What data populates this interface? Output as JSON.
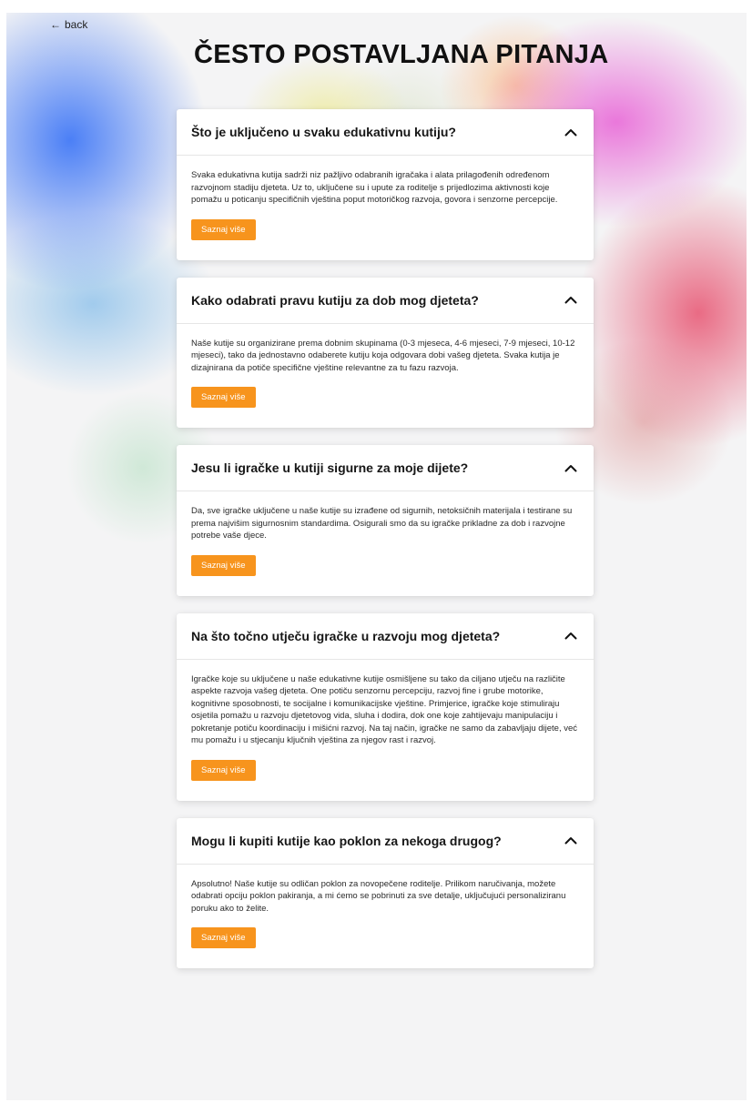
{
  "nav": {
    "back_arrow": "←",
    "back_label": "back"
  },
  "page": {
    "title": "ČESTO POSTAVLJANA PITANJA"
  },
  "faq": {
    "items": [
      {
        "question": "Što je uključeno u svaku edukativnu kutiju?",
        "answer": "Svaka edukativna kutija sadrži niz pažljivo odabranih igračaka i alata prilagođenih određenom razvojnom stadiju djeteta. Uz to, uključene su i upute za roditelje s prijedlozima aktivnosti koje pomažu u poticanju specifičnih vještina poput motoričkog razvoja, govora i senzorne percepcije.",
        "button_label": "Saznaj više",
        "expanded_icon": "chevron-up-icon"
      },
      {
        "question": "Kako odabrati pravu kutiju za dob mog djeteta?",
        "answer": "Naše kutije su organizirane prema dobnim skupinama (0-3 mjeseca, 4-6 mjeseci, 7-9 mjeseci, 10-12 mjeseci), tako da jednostavno odaberete kutiju koja odgovara dobi vašeg djeteta. Svaka kutija je dizajnirana da potiče specifične vještine relevantne za tu fazu razvoja.",
        "button_label": "Saznaj više",
        "expanded_icon": "chevron-up-icon"
      },
      {
        "question": "Jesu li igračke u kutiji sigurne za moje dijete?",
        "answer": "Da, sve igračke uključene u naše kutije su izrađene od sigurnih, netoksičnih materijala i testirane su prema najvišim sigurnosnim standardima. Osigurali smo da su igračke prikladne za dob i razvojne potrebe vaše djece.",
        "button_label": "Saznaj više",
        "expanded_icon": "chevron-up-icon"
      },
      {
        "question": "Na što točno utječu igračke u razvoju mog djeteta?",
        "answer": "Igračke koje su uključene u naše edukativne kutije osmišljene su tako da ciljano utječu na različite aspekte razvoja vašeg djeteta. One potiču senzornu percepciju, razvoj fine i grube motorike, kognitivne sposobnosti, te socijalne i komunikacijske vještine. Primjerice, igračke koje stimuliraju osjetila pomažu u razvoju djetetovog vida, sluha i dodira, dok one koje zahtijevaju manipulaciju i pokretanje potiču koordinaciju i mišićni razvoj. Na taj način, igračke ne samo da zabavljaju dijete, već mu pomažu i u stjecanju ključnih vještina za njegov rast i razvoj.",
        "button_label": "Saznaj više",
        "expanded_icon": "chevron-up-icon"
      },
      {
        "question": "Mogu li kupiti kutije kao poklon za nekoga drugog?",
        "answer": "Apsolutno! Naše kutije su odličan poklon za novopečene roditelje. Prilikom naručivanja, možete odabrati opciju poklon pakiranja, a mi ćemo se pobrinuti za sve detalje, uključujući personaliziranu poruku ako to želite.",
        "button_label": "Saznaj više",
        "expanded_icon": "chevron-up-icon"
      }
    ]
  },
  "colors": {
    "accent": "#f7941d",
    "card_background": "#ffffff",
    "page_background": "#f4f4f5"
  }
}
